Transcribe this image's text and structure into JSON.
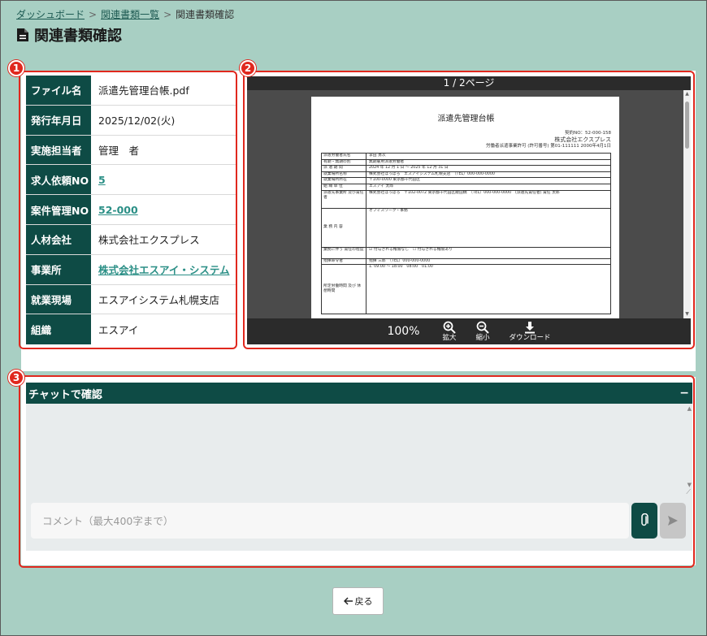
{
  "breadcrumb": {
    "items": [
      "ダッシュボード",
      "関連書類一覧"
    ],
    "current": "関連書類確認",
    "separator": ">"
  },
  "page_title": "関連書類確認",
  "info": {
    "rows": [
      {
        "label": "ファイル名",
        "value": "派遣先管理台帳.pdf"
      },
      {
        "label": "発行年月日",
        "value": "2025/12/02(火)"
      },
      {
        "label": "実施担当者",
        "value": "管理　者"
      },
      {
        "label": "求人依頼NO",
        "value": "5"
      },
      {
        "label": "案件管理NO",
        "value": "52-000"
      },
      {
        "label": "人材会社",
        "value": "株式会社エクスプレス"
      },
      {
        "label": "事業所",
        "value": "株式会社エスアイ・システム"
      },
      {
        "label": "就業現場",
        "value": "エスアイシステム札幌支店"
      },
      {
        "label": "組織",
        "value": "エスアイ"
      }
    ]
  },
  "viewer": {
    "page_indicator": "1 / 2ページ",
    "zoom": "100%",
    "zoom_in_label": "拡大",
    "zoom_out_label": "縮小",
    "download_label": "ダウンロード",
    "doc": {
      "title": "派遣先管理台帳",
      "meta1": "契約NO：52-000-158",
      "meta2": "株式会社エクスプレス",
      "meta3": "労働者派遣事業許可 (許可番号) 第01-111111 2000年4月1日",
      "rows": [
        {
          "l": "派遣労働者氏名",
          "v": "李田 勇次"
        },
        {
          "l": "有期・無期の別",
          "v": "無期雇用派遣労働者"
        },
        {
          "l": "派 遣 期 間",
          "v": "2024 年 12 月 1 日 ～ 2025 年 12 月 31 日"
        },
        {
          "l": "就業場所名称",
          "v": "株式会社ほっぽろ　エスアイシステム札幌支店　（TEL）000-000-0000"
        },
        {
          "l": "就業場所所在",
          "v": "〒100-0000 東京都千代田区"
        },
        {
          "l": "組 織 単 位",
          "v": "エスアイ 太郎"
        },
        {
          "l": "派遣先事業所 及び責任者",
          "v": "株式会社ほっぽろ　〒102-0072 東京都千代田区飯田橋　（TEL）000-000-0000　(派遣先責任者) 責任 太郎"
        },
        {
          "l": "業 務 内 容",
          "v": "オフィスワーク・事務"
        },
        {
          "l": "",
          "v": ""
        },
        {
          "l": "業務に伴う 責任の程度",
          "v": "☑ 付与される権限なし　☐ 付与される権限あり"
        },
        {
          "l": "指揮命令者",
          "v": "指揮 三郎　（TEL）000-000-0000"
        },
        {
          "l": "所定労働時間 及び 休憩時間",
          "v": "1. 09:00 ～ 18:00　08:00　01:00"
        }
      ]
    }
  },
  "chat": {
    "title": "チャットで確認",
    "collapse": "−",
    "placeholder": "コメント（最大400字まで）"
  },
  "callouts": [
    "1",
    "2",
    "3"
  ],
  "back_label": "戻る",
  "colors": {
    "accent": "#0e4b45",
    "background": "#a8cfc3",
    "callout": "#e0281e",
    "link": "#2b8f86"
  }
}
